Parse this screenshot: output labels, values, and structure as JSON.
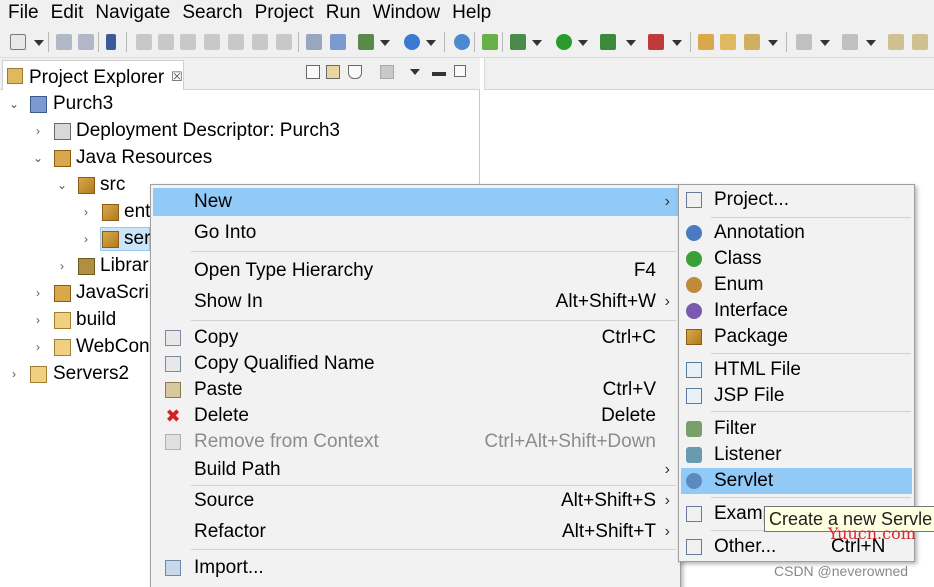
{
  "menubar": {
    "items": [
      "File",
      "Edit",
      "Navigate",
      "Search",
      "Project",
      "Run",
      "Window",
      "Help"
    ]
  },
  "explorer": {
    "title": "Project Explorer",
    "close_glyph": "☒",
    "tree": [
      {
        "label": "Purch3",
        "expanded": true
      },
      {
        "label": "Deployment Descriptor: Purch3"
      },
      {
        "label": "Java Resources",
        "expanded": true
      },
      {
        "label": "src",
        "expanded": true
      },
      {
        "label": "ent"
      },
      {
        "label": "ser"
      },
      {
        "label": "Librar"
      },
      {
        "label": "JavaScrip"
      },
      {
        "label": "build"
      },
      {
        "label": "WebCon"
      },
      {
        "label": "Servers2"
      }
    ]
  },
  "context_menu": {
    "items": [
      {
        "label": "New",
        "shortcut": "",
        "submenu": true,
        "highlighted": true
      },
      {
        "label": "Go Into",
        "shortcut": ""
      },
      {
        "label": "Open Type Hierarchy",
        "shortcut": "F4"
      },
      {
        "label": "Show In",
        "shortcut": "Alt+Shift+W",
        "submenu": true
      },
      {
        "label": "Copy",
        "shortcut": "Ctrl+C"
      },
      {
        "label": "Copy Qualified Name",
        "shortcut": ""
      },
      {
        "label": "Paste",
        "shortcut": "Ctrl+V"
      },
      {
        "label": "Delete",
        "shortcut": "Delete"
      },
      {
        "label": "Remove from Context",
        "shortcut": "Ctrl+Alt+Shift+Down",
        "disabled": true
      },
      {
        "label": "Build Path",
        "shortcut": "",
        "submenu": true
      },
      {
        "label": "Source",
        "shortcut": "Alt+Shift+S",
        "submenu": true
      },
      {
        "label": "Refactor",
        "shortcut": "Alt+Shift+T",
        "submenu": true
      },
      {
        "label": "Import...",
        "shortcut": ""
      }
    ],
    "arrow_glyph": "›"
  },
  "new_submenu": {
    "items": [
      {
        "label": "Project...",
        "shortcut": ""
      },
      {
        "label": "Annotation",
        "shortcut": ""
      },
      {
        "label": "Class",
        "shortcut": ""
      },
      {
        "label": "Enum",
        "shortcut": ""
      },
      {
        "label": "Interface",
        "shortcut": ""
      },
      {
        "label": "Package",
        "shortcut": ""
      },
      {
        "label": "HTML File",
        "shortcut": ""
      },
      {
        "label": "JSP File",
        "shortcut": ""
      },
      {
        "label": "Filter",
        "shortcut": ""
      },
      {
        "label": "Listener",
        "shortcut": ""
      },
      {
        "label": "Servlet",
        "shortcut": "",
        "highlighted": true
      },
      {
        "label": "Examp",
        "shortcut": ""
      },
      {
        "label": "Other...",
        "shortcut": "Ctrl+N"
      }
    ]
  },
  "tooltip": {
    "text": "Create a new Servle"
  },
  "watermarks": {
    "site": "Yuucn.com",
    "credit": "CSDN @neverowned"
  },
  "colors": {
    "highlight": "#91c9f7",
    "menu_bg": "#f2f2f2",
    "chrome_bg": "#f0f0f0"
  }
}
